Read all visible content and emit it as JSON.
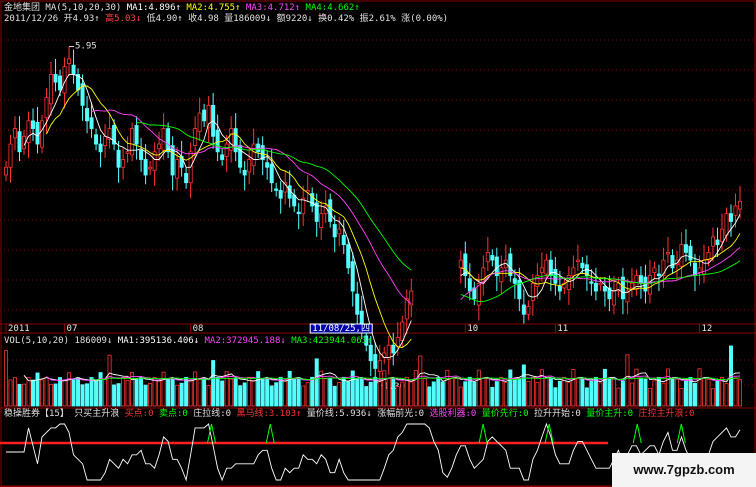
{
  "header": {
    "line1": [
      {
        "text": "金地集团",
        "color": "#e0e0e0"
      },
      {
        "text": "MA(5,10,20,30)",
        "color": "#e0e0e0"
      },
      {
        "text": "MA1:4.896↑",
        "color": "#ffffff"
      },
      {
        "text": "MA2:4.755↑",
        "color": "#ffff00"
      },
      {
        "text": "MA3:4.712↑",
        "color": "#ff44ff"
      },
      {
        "text": "MA4:4.662↑",
        "color": "#00ff00"
      }
    ],
    "line2": [
      {
        "text": "2011/12/26",
        "color": "#e0e0e0"
      },
      {
        "text": "开4.93↑",
        "color": "#e0e0e0"
      },
      {
        "text": "高5.03↓",
        "color": "#ff4444"
      },
      {
        "text": "低4.90↑",
        "color": "#e0e0e0"
      },
      {
        "text": "收4.98",
        "color": "#e0e0e0"
      },
      {
        "text": "量186009↓",
        "color": "#e0e0e0"
      },
      {
        "text": "额9220↓",
        "color": "#e0e0e0"
      },
      {
        "text": "换0.42%",
        "color": "#e0e0e0"
      },
      {
        "text": "振2.61%",
        "color": "#e0e0e0"
      },
      {
        "text": "涨(0.00%)",
        "color": "#e0e0e0"
      }
    ],
    "vol_line": [
      {
        "text": "VOL(5,10,20)",
        "color": "#e0e0e0"
      },
      {
        "text": "186009↓",
        "color": "#e0e0e0"
      },
      {
        "text": "MA1:395136.406↓",
        "color": "#ffffff"
      },
      {
        "text": "MA2:372945.188↓",
        "color": "#ff44ff"
      },
      {
        "text": "MA3:423944.063↑",
        "color": "#00ff00"
      }
    ],
    "ind_line": [
      {
        "text": "稳操胜券【15】",
        "color": "#e0e0e0"
      },
      {
        "text": "只买主升浪",
        "color": "#e0e0e0"
      },
      {
        "text": "买点:0",
        "color": "#ff3333"
      },
      {
        "text": "卖点:0",
        "color": "#00ff00"
      },
      {
        "text": "庄拉线:0",
        "color": "#e0e0e0"
      },
      {
        "text": "黑马线:3.103↑",
        "color": "#ff3333"
      },
      {
        "text": "量价线:5.936↓",
        "color": "#e0e0e0"
      },
      {
        "text": "涨幅前光:0",
        "color": "#e0e0e0"
      },
      {
        "text": "选股利器:0",
        "color": "#ff44ff"
      },
      {
        "text": "量价先行:0",
        "color": "#00ff00"
      },
      {
        "text": "拉升开始:0",
        "color": "#e0e0e0"
      },
      {
        "text": "量价主升:0",
        "color": "#00ff00"
      },
      {
        "text": "庄控主升浪:0",
        "color": "#ff3333"
      }
    ]
  },
  "price_labels": {
    "high": "5.95",
    "low": "4.30"
  },
  "date_axis": {
    "ticks": [
      {
        "label": "2011",
        "idx": 0
      },
      {
        "label": "07",
        "idx": 13
      },
      {
        "label": "08",
        "idx": 41
      },
      {
        "label": "10",
        "idx": 102
      },
      {
        "label": "11",
        "idx": 122
      },
      {
        "label": "12",
        "idx": 154
      }
    ],
    "highlight": "11/08/25,四",
    "highlight_idx": 68
  },
  "watermark": "www.7gpzb.com",
  "colors": {
    "up": "#ff3333",
    "down": "#54ffff",
    "grid": "#8b0000",
    "ma1": "#ffffff",
    "ma2": "#ffff00",
    "ma3": "#ff44ff",
    "ma4": "#00ff00"
  },
  "chart_data": {
    "type": "candlestick",
    "ylim": [
      4.2,
      6.1
    ],
    "gap": [
      91,
      100
    ],
    "closes": [
      5.2,
      5.35,
      5.45,
      5.3,
      5.4,
      5.5,
      5.45,
      5.35,
      5.5,
      5.65,
      5.8,
      5.75,
      5.7,
      5.85,
      5.9,
      5.8,
      5.7,
      5.6,
      5.5,
      5.45,
      5.35,
      5.3,
      5.4,
      5.45,
      5.35,
      5.2,
      5.25,
      5.3,
      5.45,
      5.35,
      5.25,
      5.15,
      5.2,
      5.3,
      5.35,
      5.45,
      5.3,
      5.15,
      5.25,
      5.2,
      5.1,
      5.3,
      5.45,
      5.55,
      5.5,
      5.6,
      5.4,
      5.3,
      5.25,
      5.35,
      5.45,
      5.3,
      5.2,
      5.15,
      5.25,
      5.35,
      5.3,
      5.25,
      5.2,
      5.1,
      5.05,
      5.0,
      5.1,
      5.0,
      4.95,
      4.9,
      5.0,
      5.05,
      4.95,
      4.85,
      4.9,
      4.95,
      4.85,
      4.75,
      4.8,
      4.7,
      4.55,
      4.4,
      4.25,
      4.15,
      4.05,
      3.95,
      3.9,
      3.95,
      4.0,
      4.05,
      4.0,
      4.1,
      4.2,
      4.35,
      4.4,
      4.45,
      4.6,
      4.7,
      4.65,
      4.55,
      4.5,
      4.4,
      4.45,
      4.5,
      4.55,
      4.6,
      4.5,
      4.4,
      4.35,
      4.45,
      4.55,
      4.65,
      4.6,
      4.5,
      4.55,
      4.6,
      4.5,
      4.45,
      4.35,
      4.25,
      4.3,
      4.45,
      4.5,
      4.55,
      4.6,
      4.5,
      4.45,
      4.4,
      4.45,
      4.5,
      4.55,
      4.6,
      4.55,
      4.5,
      4.45,
      4.4,
      4.45,
      4.4,
      4.35,
      4.4,
      4.45,
      4.35,
      4.4,
      4.45,
      4.5,
      4.45,
      4.4,
      4.5,
      4.55,
      4.5,
      4.6,
      4.65,
      4.55,
      4.6,
      4.7,
      4.65,
      4.6,
      4.5,
      4.55,
      4.6,
      4.65,
      4.75,
      4.7,
      4.8,
      4.9,
      4.85,
      4.95,
      4.98
    ]
  }
}
